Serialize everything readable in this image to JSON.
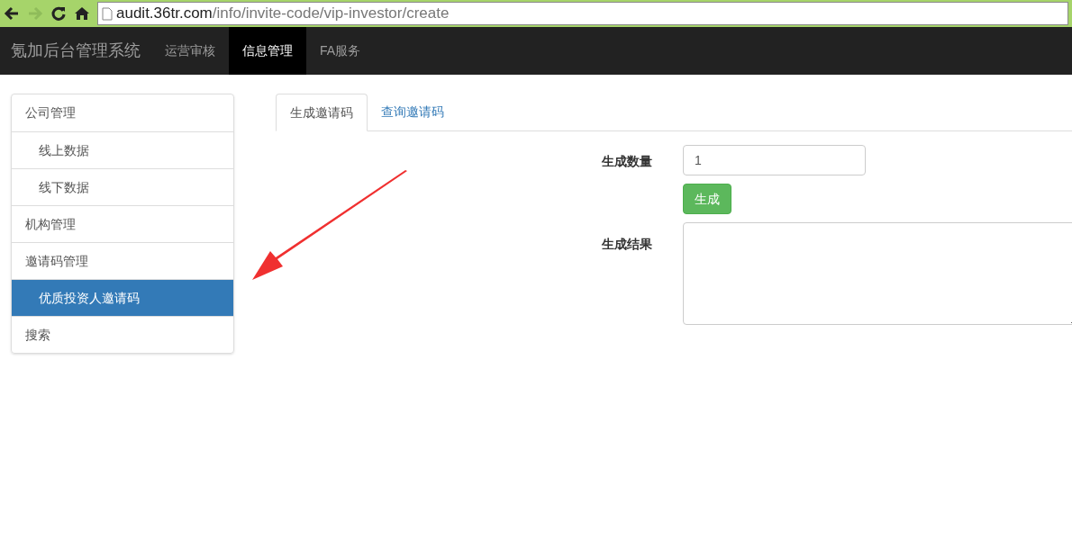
{
  "browser": {
    "url_host": "audit.36tr.com",
    "url_path": "/info/invite-code/vip-investor/create"
  },
  "navbar": {
    "brand": "氪加后台管理系统",
    "items": [
      {
        "label": "运营审核",
        "selected": false
      },
      {
        "label": "信息管理",
        "selected": true
      },
      {
        "label": "FA服务",
        "selected": false
      }
    ]
  },
  "sidebar": {
    "items": [
      {
        "label": "公司管理",
        "selected": false,
        "children": [
          {
            "label": "线上数据",
            "selected": false
          },
          {
            "label": "线下数据",
            "selected": false
          }
        ]
      },
      {
        "label": "机构管理",
        "selected": false
      },
      {
        "label": "邀请码管理",
        "selected": false,
        "children": [
          {
            "label": "优质投资人邀请码",
            "selected": true
          }
        ]
      },
      {
        "label": "搜索",
        "selected": false
      }
    ]
  },
  "tabs": [
    {
      "label": "生成邀请码",
      "selected": true
    },
    {
      "label": "查询邀请码",
      "selected": false
    }
  ],
  "form": {
    "count_label": "生成数量",
    "count_value": "1",
    "generate_button": "生成",
    "result_label": "生成结果"
  }
}
